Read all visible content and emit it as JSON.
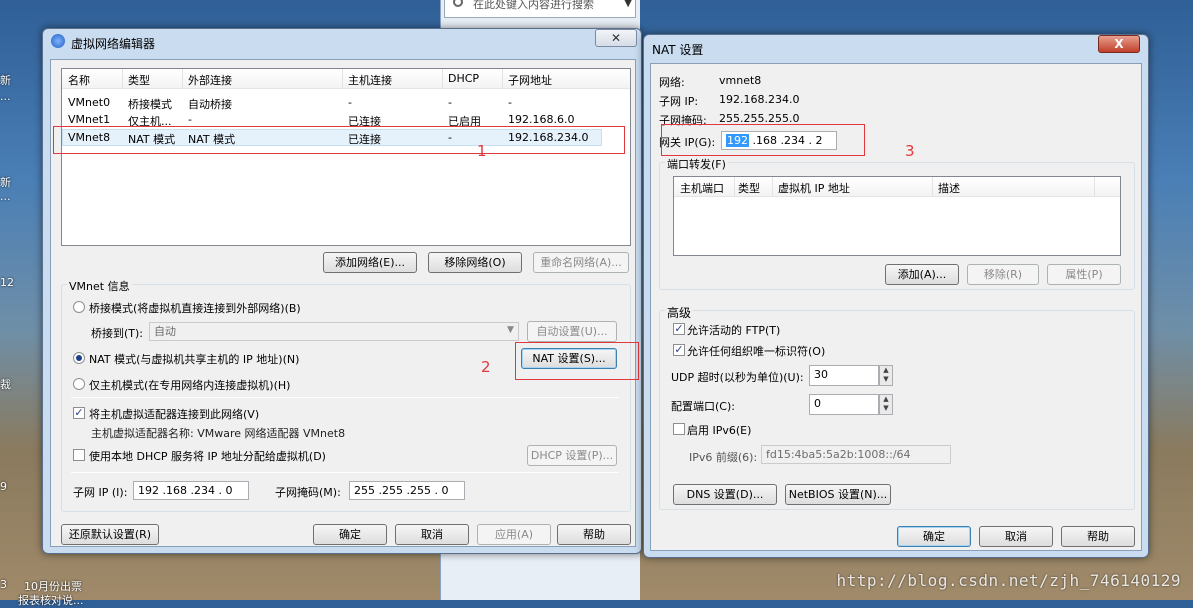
{
  "desktop": {
    "left_labels": [
      "新",
      "...",
      "新",
      "...",
      "12",
      "裁",
      "9",
      "3"
    ],
    "bottom_item": "10月份出票",
    "bottom_item2": "报表核对说...",
    "search_placeholder": "在此处键入内容进行搜索",
    "watermark": "http://blog.csdn.net/zjh_746140129"
  },
  "vne": {
    "title": "虚拟网络编辑器",
    "close": "✕",
    "columns": [
      "名称",
      "类型",
      "外部连接",
      "主机连接",
      "DHCP",
      "子网地址"
    ],
    "rows": [
      [
        "VMnet0",
        "桥接模式",
        "自动桥接",
        "-",
        "-",
        "-"
      ],
      [
        "VMnet1",
        "仅主机...",
        "-",
        "已连接",
        "已启用",
        "192.168.6.0"
      ],
      [
        "VMnet8",
        "NAT 模式",
        "NAT 模式",
        "已连接",
        "-",
        "192.168.234.0"
      ]
    ],
    "add_network": "添加网络(E)...",
    "remove_network": "移除网络(O)",
    "rename_network": "重命名网络(A)...",
    "vmnet_info": "VMnet 信息",
    "bridge_mode": "桥接模式(将虚拟机直接连接到外部网络)(B)",
    "bridge_to_label": "桥接到(T):",
    "bridge_to_value": "自动",
    "auto_settings": "自动设置(U)...",
    "nat_mode": "NAT 模式(与虚拟机共享主机的 IP 地址)(N)",
    "nat_settings": "NAT 设置(S)...",
    "host_only": "仅主机模式(在专用网络内连接虚拟机)(H)",
    "connect_adapter": "将主机虚拟适配器连接到此网络(V)",
    "adapter_name": "主机虚拟适配器名称: VMware 网络适配器 VMnet8",
    "use_dhcp": "使用本地 DHCP 服务将 IP 地址分配给虚拟机(D)",
    "dhcp_settings": "DHCP 设置(P)...",
    "subnet_ip_label": "子网 IP (I):",
    "subnet_ip": "192 .168 .234 .  0",
    "subnet_mask_label": "子网掩码(M):",
    "subnet_mask": "255 .255 .255 .  0",
    "restore_defaults": "还原默认设置(R)",
    "ok": "确定",
    "cancel": "取消",
    "apply": "应用(A)",
    "help": "帮助",
    "annot1": "1",
    "annot2": "2"
  },
  "nat": {
    "title": "NAT 设置",
    "close": "X",
    "network_label": "网络:",
    "network_value": "vmnet8",
    "subnet_ip_label": "子网 IP:",
    "subnet_ip_value": "192.168.234.0",
    "subnet_mask_label": "子网掩码:",
    "subnet_mask_value": "255.255.255.0",
    "gateway_label": "网关 IP(G):",
    "gateway_first": "192",
    "gateway_rest": " .168 .234 .  2",
    "port_forward": "端口转发(F)",
    "pf_columns": [
      "主机端口",
      "类型",
      "虚拟机 IP 地址",
      "描述"
    ],
    "add": "添加(A)...",
    "remove": "移除(R)",
    "properties": "属性(P)",
    "advanced": "高级",
    "allow_ftp": "允许活动的 FTP(T)",
    "allow_oui": "允许任何组织唯一标识符(O)",
    "udp_timeout_label": "UDP 超时(以秒为单位)(U):",
    "udp_timeout": "30",
    "config_port_label": "配置端口(C):",
    "config_port": "0",
    "enable_ipv6": "启用 IPv6(E)",
    "ipv6_prefix_label": "IPv6 前缀(6):",
    "ipv6_prefix": "fd15:4ba5:5a2b:1008::/64",
    "dns_settings": "DNS 设置(D)...",
    "netbios_settings": "NetBIOS 设置(N)...",
    "ok": "确定",
    "cancel": "取消",
    "help": "帮助",
    "annot3": "3"
  }
}
